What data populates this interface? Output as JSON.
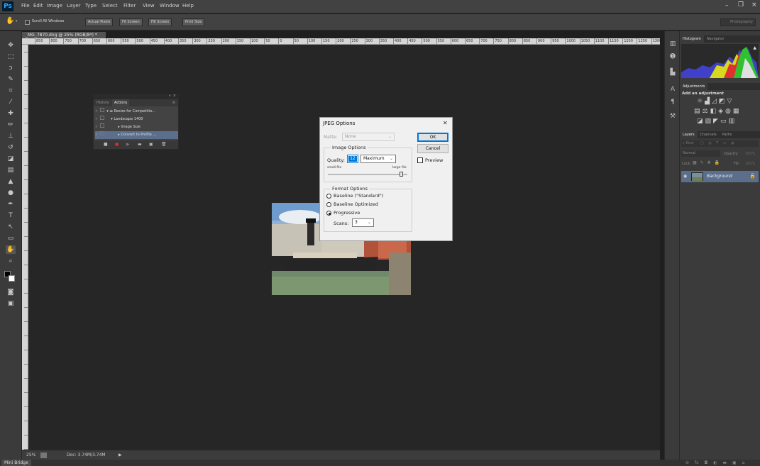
{
  "app": {
    "logo": "Ps",
    "workspace": "Photography"
  },
  "menu": [
    "File",
    "Edit",
    "Image",
    "Layer",
    "Type",
    "Select",
    "Filter",
    "View",
    "Window",
    "Help"
  ],
  "window_controls": {
    "minimize": "–",
    "restore": "❐",
    "close": "×"
  },
  "options_bar": {
    "scroll_all_windows": "Scroll All Windows",
    "buttons": [
      "Actual Pixels",
      "Fit Screen",
      "Fill Screen",
      "Print Size"
    ]
  },
  "document": {
    "tab_title": "_MG_7870.dng @ 25% (RGB/8*) *",
    "ruler_ticks": [
      "850",
      "800",
      "750",
      "700",
      "650",
      "600",
      "550",
      "500",
      "450",
      "400",
      "350",
      "300",
      "250",
      "200",
      "150",
      "100",
      "50",
      "0",
      "50",
      "100",
      "150",
      "200",
      "250",
      "300",
      "350",
      "400",
      "450",
      "500",
      "550",
      "600",
      "650",
      "700",
      "750",
      "800",
      "850",
      "900",
      "950",
      "1000",
      "1050",
      "1100",
      "1150",
      "1200",
      "1250",
      "1300"
    ],
    "zoom": "25%",
    "doc_size": "Doc: 3.74M/3.74M"
  },
  "bottom_bar": {
    "mini_bridge": "Mini Bridge"
  },
  "actions_panel": {
    "tabs": [
      "History",
      "Actions"
    ],
    "rows": [
      {
        "label": "Resize for Competitio...",
        "indent": 0
      },
      {
        "label": "Landscape 1400",
        "indent": 1
      },
      {
        "label": "Image Size",
        "indent": 2
      },
      {
        "label": "Convert to Profile ...",
        "indent": 2
      }
    ]
  },
  "jpeg_dialog": {
    "title": "JPEG Options",
    "close": "✕",
    "matte_label": "Matte:",
    "matte_value": "None",
    "ok": "OK",
    "cancel": "Cancel",
    "preview": "Preview",
    "image_options": "Image Options",
    "quality_label": "Quality:",
    "quality_value": "12",
    "quality_preset": "Maximum",
    "small_file": "small file",
    "large_file": "large file",
    "quality_fraction": 0.92,
    "format_options": "Format Options",
    "formats": [
      "Baseline (\"Standard\")",
      "Baseline Optimized",
      "Progressive"
    ],
    "selected_format": 2,
    "scans_label": "Scans:",
    "scans_value": "3"
  },
  "panels": {
    "histogram_tabs": [
      "Histogram",
      "Navigator"
    ],
    "adjustments_tab": "Adjustments",
    "add_adjustment": "Add an adjustment",
    "layers_tabs": [
      "Layers",
      "Channels",
      "Paths"
    ],
    "kind": "Kind",
    "blend_mode": "Normal",
    "opacity_label": "Opacity:",
    "opacity_value": "100%",
    "lock_label": "Lock:",
    "fill_label": "Fill:",
    "fill_value": "100%",
    "layer_name": "Background"
  }
}
